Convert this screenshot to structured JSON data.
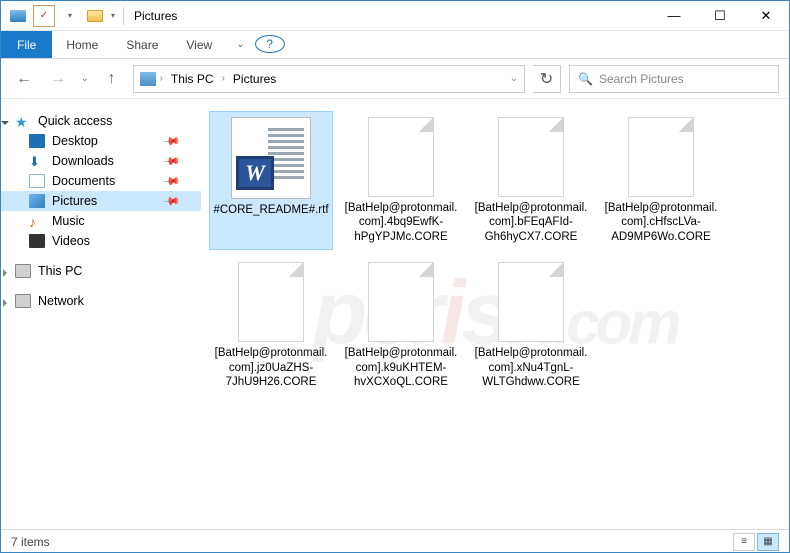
{
  "titlebar": {
    "title": "Pictures"
  },
  "ribbon": {
    "file": "File",
    "tabs": [
      "Home",
      "Share",
      "View"
    ]
  },
  "nav": {
    "crumbs": [
      "This PC",
      "Pictures"
    ],
    "search_placeholder": "Search Pictures"
  },
  "sidebar": {
    "quick_access": "Quick access",
    "items": [
      {
        "label": "Desktop",
        "icon": "desktop",
        "pinned": true
      },
      {
        "label": "Downloads",
        "icon": "downloads",
        "pinned": true
      },
      {
        "label": "Documents",
        "icon": "docs",
        "pinned": true
      },
      {
        "label": "Pictures",
        "icon": "pics",
        "pinned": true,
        "selected": true
      },
      {
        "label": "Music",
        "icon": "music",
        "pinned": false
      },
      {
        "label": "Videos",
        "icon": "videos",
        "pinned": false
      }
    ],
    "this_pc": "This PC",
    "network": "Network"
  },
  "files": [
    {
      "name": "#CORE_README#.rtf",
      "type": "rtf",
      "selected": true
    },
    {
      "name": "[BatHelp@protonmail.com].4bq9EwfK-hPgYPJMc.CORE",
      "type": "blank"
    },
    {
      "name": "[BatHelp@protonmail.com].bFEqAFId-Gh6hyCX7.CORE",
      "type": "blank"
    },
    {
      "name": "[BatHelp@protonmail.com].cHfscLVa-AD9MP6Wo.CORE",
      "type": "blank"
    },
    {
      "name": "[BatHelp@protonmail.com].jz0UaZHS-7JhU9H26.CORE",
      "type": "blank"
    },
    {
      "name": "[BatHelp@protonmail.com].k9uKHTEM-hvXCXoQL.CORE",
      "type": "blank"
    },
    {
      "name": "[BatHelp@protonmail.com].xNu4TgnL-WLTGhdww.CORE",
      "type": "blank"
    }
  ],
  "status": {
    "count_label": "7 items"
  },
  "watermark": "pcrisk.com"
}
